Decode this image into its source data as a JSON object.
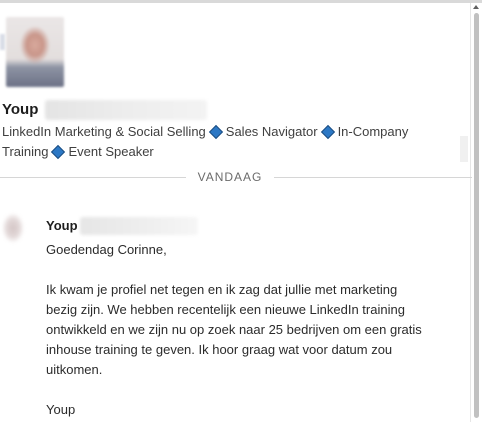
{
  "profile": {
    "name": "Youp",
    "headline": {
      "part1": "LinkedIn Marketing & Social Selling",
      "part2": "Sales Navigator",
      "part3": "In-Company",
      "line2a": "Training",
      "line2b": "Event Speaker"
    }
  },
  "divider": {
    "label": "VANDAAG"
  },
  "message": {
    "sender": "Youp",
    "greeting": "Goedendag Corinne,",
    "lines": [
      "Ik kwam je profiel net tegen en ik zag dat jullie met marketing",
      "bezig zijn. We hebben recentelijk een nieuwe LinkedIn training",
      "ontwikkeld en we zijn nu op zoek naar 25 bedrijven om een gratis",
      "inhouse training te geven. Ik hoor graag wat voor datum zou",
      "uitkomen."
    ],
    "signoff": "Youp"
  },
  "colors": {
    "accent_diamond": "#2c78c5",
    "divider": "#d6d6d6"
  }
}
